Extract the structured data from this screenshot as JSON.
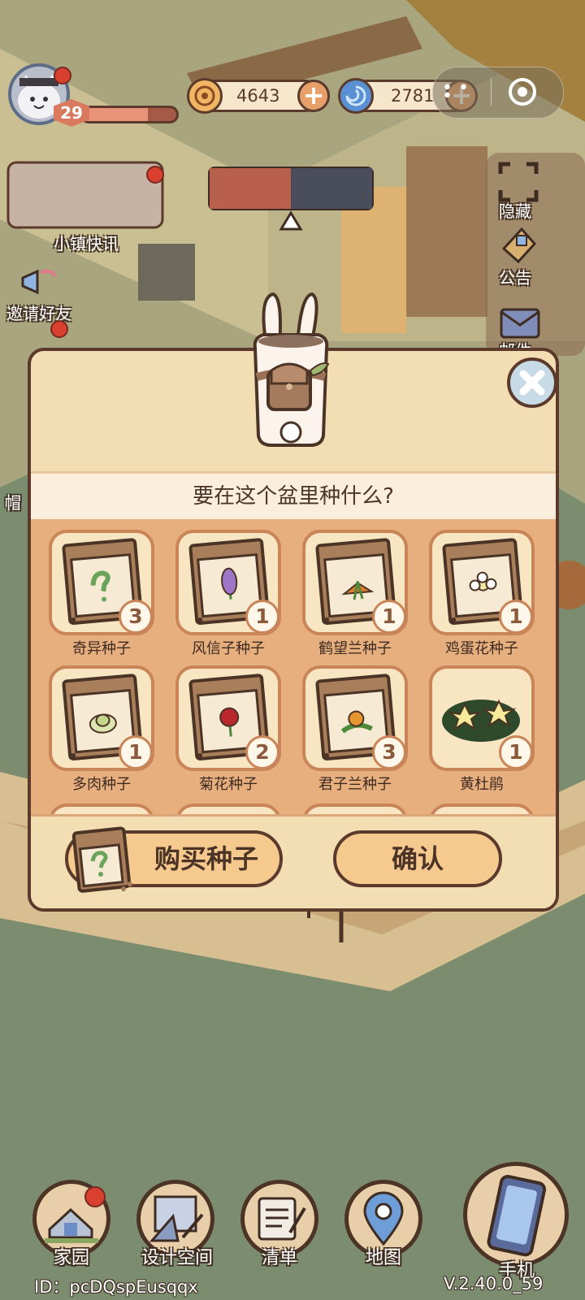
{
  "player": {
    "level": "29",
    "xp_fraction": 0.7
  },
  "currencies": [
    {
      "name": "coin",
      "value": "4643"
    },
    {
      "name": "gem",
      "value": "2781"
    }
  ],
  "side_menu": {
    "news": "小镇快讯",
    "invite": "邀请好友",
    "hat": "帽",
    "hide": "隐藏",
    "notice": "公告",
    "mail": "邮件"
  },
  "dialog": {
    "title": "要在这个盆里种什么?",
    "seeds": [
      {
        "name": "奇异种子",
        "count": "3",
        "icon": "question-seed-icon"
      },
      {
        "name": "风信子种子",
        "count": "1",
        "icon": "hyacinth-seed-icon"
      },
      {
        "name": "鹤望兰种子",
        "count": "1",
        "icon": "bird-of-paradise-seed-icon"
      },
      {
        "name": "鸡蛋花种子",
        "count": "1",
        "icon": "frangipani-seed-icon"
      },
      {
        "name": "多肉种子",
        "count": "1",
        "icon": "succulent-seed-icon"
      },
      {
        "name": "菊花种子",
        "count": "2",
        "icon": "chrysanthemum-seed-icon"
      },
      {
        "name": "君子兰种子",
        "count": "3",
        "icon": "clivia-seed-icon"
      },
      {
        "name": "黄杜鹃",
        "count": "1",
        "icon": "yellow-azalea-icon"
      }
    ],
    "buy_label": "购买种子",
    "confirm_label": "确认"
  },
  "nav": [
    {
      "label": "家园",
      "icon": "home-icon"
    },
    {
      "label": "设计空间",
      "icon": "design-icon"
    },
    {
      "label": "清单",
      "icon": "list-icon"
    },
    {
      "label": "地图",
      "icon": "map-pin-icon"
    },
    {
      "label": "手机",
      "icon": "phone-icon"
    }
  ],
  "footer": {
    "id_text": "ID：pcDQspEusqqx",
    "version": "V.2.40.0_59"
  }
}
